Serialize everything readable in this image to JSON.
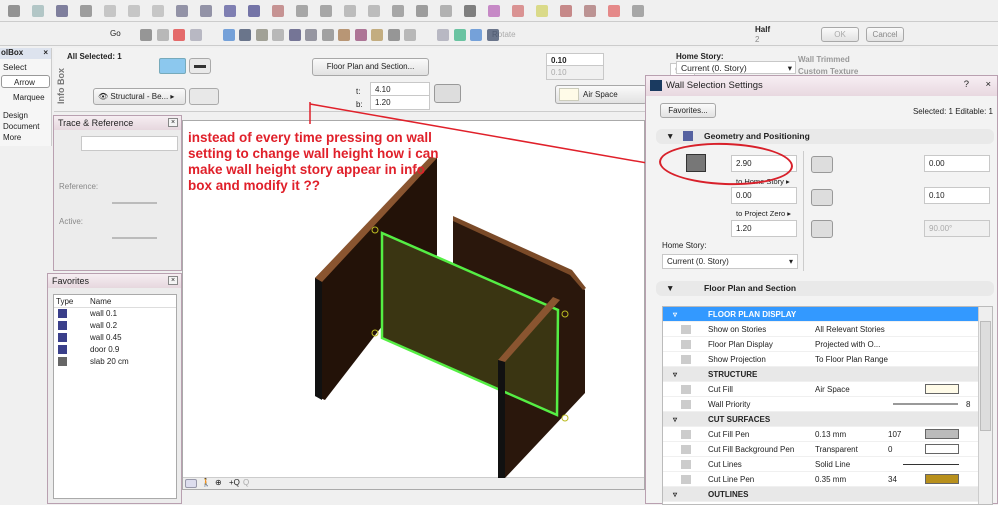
{
  "toolbar": {
    "go_label": "Go",
    "rotate_label": "Rotate",
    "half_label": "Half",
    "half_value": "2",
    "ok_label": "OK",
    "cancel_label": "Cancel"
  },
  "toolbox": {
    "title": "olBox",
    "select_label": "Select",
    "items": [
      "Arrow",
      "Marquee"
    ],
    "sections": [
      "Design",
      "Document",
      "More"
    ]
  },
  "infobox": {
    "label": "Info Box",
    "all_selected": "All Selected: 1",
    "floor_plan_button": "Floor Plan and Section...",
    "layer": "Structural - Be...",
    "t_label": "t:",
    "t_value": "4.10",
    "b_label": "b:",
    "b_value": "1.20",
    "thickness": "0.10",
    "thickness2": "0.10",
    "angle": "90.00°",
    "fill": "Air Space",
    "home_story_label": "Home Story:",
    "home_story": "Current (0. Story)",
    "wall_trimmed": "Wall Trimmed",
    "custom_texture": "Custom Texture"
  },
  "trace": {
    "title": "Trace & Reference",
    "reference_label": "Reference:",
    "active_label": "Active:"
  },
  "favorites": {
    "title": "Favorites",
    "col_type": "Type",
    "col_name": "Name",
    "items": [
      "wall 0.1",
      "wall 0.2",
      "wall 0.45",
      "door 0.9",
      "slab 20 cm"
    ]
  },
  "annotation": "instead of every time pressing on wall setting to change wall height how i can make wall height story appear in info box and modify it ??",
  "dialog": {
    "title": "Wall Selection Settings",
    "favorites_button": "Favorites...",
    "selected_info": "Selected: 1 Editable: 1",
    "geometry_title": "Geometry and Positioning",
    "height": "2.90",
    "to_home_story": "to Home Story",
    "base_offset": "0.00",
    "to_project_zero": "to Project Zero",
    "bottom": "1.20",
    "home_story_label": "Home Story:",
    "home_story": "Current (0. Story)",
    "offset_right": "0.00",
    "thickness": "0.10",
    "angle": "90.00°",
    "floor_plan_title": "Floor Plan and Section",
    "rows": [
      {
        "type": "section",
        "label": "FLOOR PLAN DISPLAY",
        "selected": true
      },
      {
        "label": "Show on Stories",
        "value": "All Relevant Stories"
      },
      {
        "label": "Floor Plan Display",
        "value": "Projected with O..."
      },
      {
        "label": "Show Projection",
        "value": "To Floor Plan Range"
      },
      {
        "type": "section",
        "label": "STRUCTURE"
      },
      {
        "label": "Cut Fill",
        "value": "Air Space"
      },
      {
        "label": "Wall Priority",
        "value": "",
        "num": "8"
      },
      {
        "type": "section",
        "label": "CUT SURFACES"
      },
      {
        "label": "Cut Fill Pen",
        "value": "0.13 mm",
        "num": "107"
      },
      {
        "label": "Cut Fill Background Pen",
        "value": "Transparent",
        "num": "0"
      },
      {
        "label": "Cut Lines",
        "value": "Solid Line"
      },
      {
        "label": "Cut Line Pen",
        "value": "0.35 mm",
        "num": "34"
      },
      {
        "type": "section",
        "label": "OUTLINES"
      }
    ]
  },
  "colors": {
    "annotation": "#e0202a",
    "selection": "#3399ff",
    "selected_wall": "#55ee44",
    "wall": "#2a170c"
  }
}
